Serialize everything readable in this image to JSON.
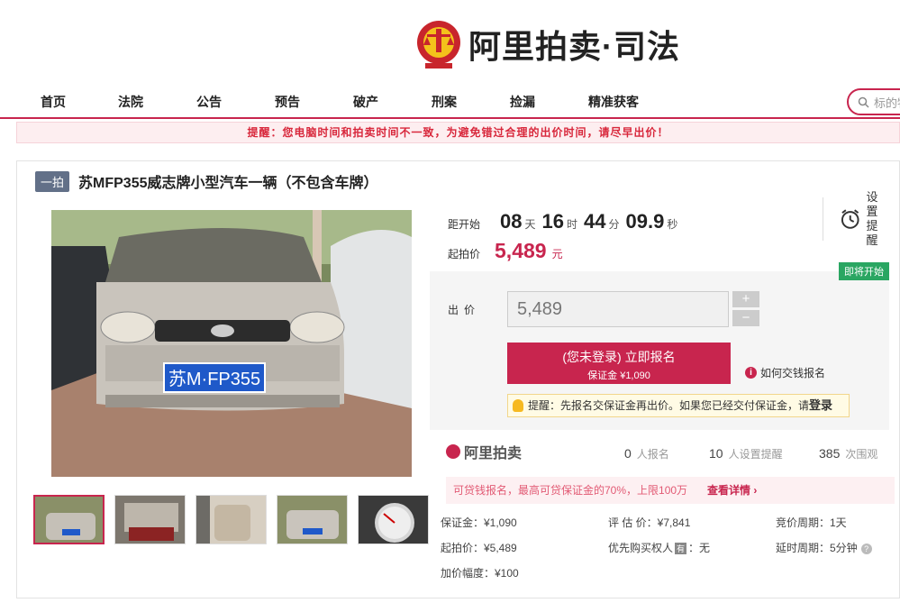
{
  "brand": {
    "title": "阿里拍卖·司法"
  },
  "nav": {
    "items": [
      "首页",
      "法院",
      "公告",
      "预告",
      "破产",
      "刑案",
      "捡漏",
      "精准获客"
    ],
    "search_placeholder": "标的物"
  },
  "notice": "提醒：您电脑时间和拍卖时间不一致，为避免错过合理的出价时间，请尽早出价！",
  "item": {
    "badge": "一拍",
    "title": "苏MFP355威志牌小型汽车一辆（不包含车牌）",
    "plate": "苏M·FP355"
  },
  "countdown": {
    "label": "距开始",
    "days": "08",
    "days_unit": "天",
    "hours": "16",
    "hours_unit": "时",
    "minutes": "44",
    "minutes_unit": "分",
    "seconds": "09.9",
    "seconds_unit": "秒"
  },
  "start_price": {
    "label": "起拍价",
    "value": "5,489",
    "unit": "元"
  },
  "remind": {
    "line1": "设置",
    "line2": "提醒"
  },
  "status_tag": "即将开始",
  "bid": {
    "label": "出价",
    "value": "5,489",
    "plus": "+",
    "minus": "−"
  },
  "signup": {
    "line1": "(您未登录) 立即报名",
    "line2": "保证金 ¥1,090"
  },
  "howto": "如何交钱报名",
  "hint": {
    "text": "提醒：先报名交保证金再出价。如果您已经交付保证金，请",
    "link": "登录"
  },
  "ali_logo": "阿里拍卖",
  "stats": {
    "signups": "0",
    "signups_label": "人报名",
    "reminders": "10",
    "reminders_label": "人设置提醒",
    "views": "385",
    "views_label": "次围观"
  },
  "loan": {
    "text": "可贷钱报名，最高可贷保证金的70%，上限100万",
    "link": "查看详情 ›"
  },
  "details": {
    "deposit": "保证金：¥1,090",
    "estimate": "评 估 价：¥7,841",
    "cycle": "竞价周期：1天",
    "start": "起拍价：¥5,489",
    "priority": "优先购买权人",
    "priority_tag": "有",
    "priority_value": "：无",
    "extend": "延时周期：5分钟",
    "increment": "加价幅度：¥100"
  },
  "colors": {
    "accent": "#c8254e",
    "green": "#2aa662"
  }
}
